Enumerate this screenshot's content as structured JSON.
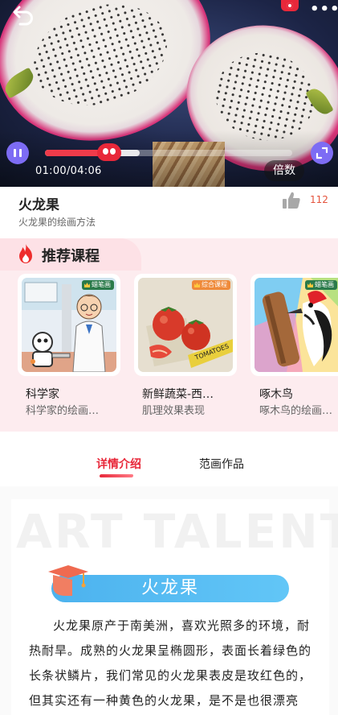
{
  "player": {
    "current_time": "01:00",
    "duration": "04:06",
    "time_display": "01:00/04:06",
    "progress_fraction": 0.244,
    "buffered_fraction": 0.382,
    "speed_label": "倍数"
  },
  "course": {
    "title": "火龙果",
    "subtitle": "火龙果的绘画方法",
    "like_count": "112"
  },
  "recommend": {
    "heading": "推荐课程",
    "items": [
      {
        "tag": "蜡笔画",
        "name": "科学家",
        "desc": "科学家的绘画…",
        "icon": "scientist-robot-painting"
      },
      {
        "tag": "综合课程",
        "name": "新鲜蔬菜-西…",
        "desc": "肌理效果表现",
        "icon": "tomatoes-painting"
      },
      {
        "tag": "蜡笔画",
        "name": "啄木鸟",
        "desc": "啄木鸟的绘画…",
        "icon": "woodpecker-painting"
      }
    ]
  },
  "tabs": [
    {
      "label": "详情介绍",
      "active": true
    },
    {
      "label": "范画作品",
      "active": false
    }
  ],
  "detail": {
    "watermark": "ART TALENT",
    "banner_title": "火龙果",
    "intro": "火龙果原产于南美洲，喜欢光照多的环境，耐热耐旱。成熟的火龙果呈椭圆形，表面长着绿色的长条状鳞片，我们常见的火龙果表皮是玫红色的，但其实还有一种黄色的火龙果，是不是也很漂亮呢！火龙果的果肉有白色和红色两种，有白色"
  },
  "colors": {
    "accent_red": "#e8283a",
    "player_purple": "#7d6cf4",
    "recommend_bg": "#fdecef",
    "banner_blue": "#4cb2ee"
  }
}
